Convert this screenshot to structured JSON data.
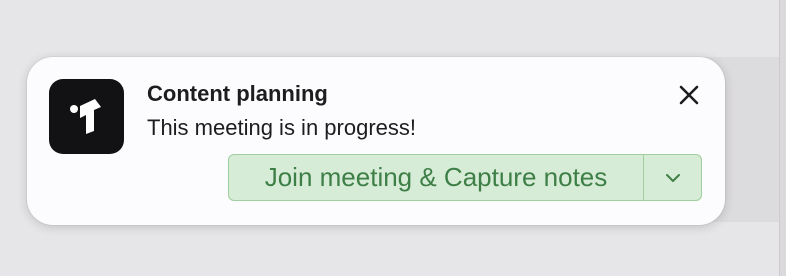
{
  "notification": {
    "title": "Content planning",
    "message": "This meeting is in progress!",
    "app_icon": "t-logo-icon",
    "close_icon": "close-icon"
  },
  "actions": {
    "primary_label": "Join meeting & Capture notes",
    "dropdown_icon": "chevron-down-icon"
  },
  "colors": {
    "toast_background": "#fcfbfd",
    "app_icon_background": "#121214",
    "button_background": "#d6ecd6",
    "button_border": "#9fcf9d",
    "button_text": "#3e7f47",
    "text": "#1d1d1f"
  }
}
